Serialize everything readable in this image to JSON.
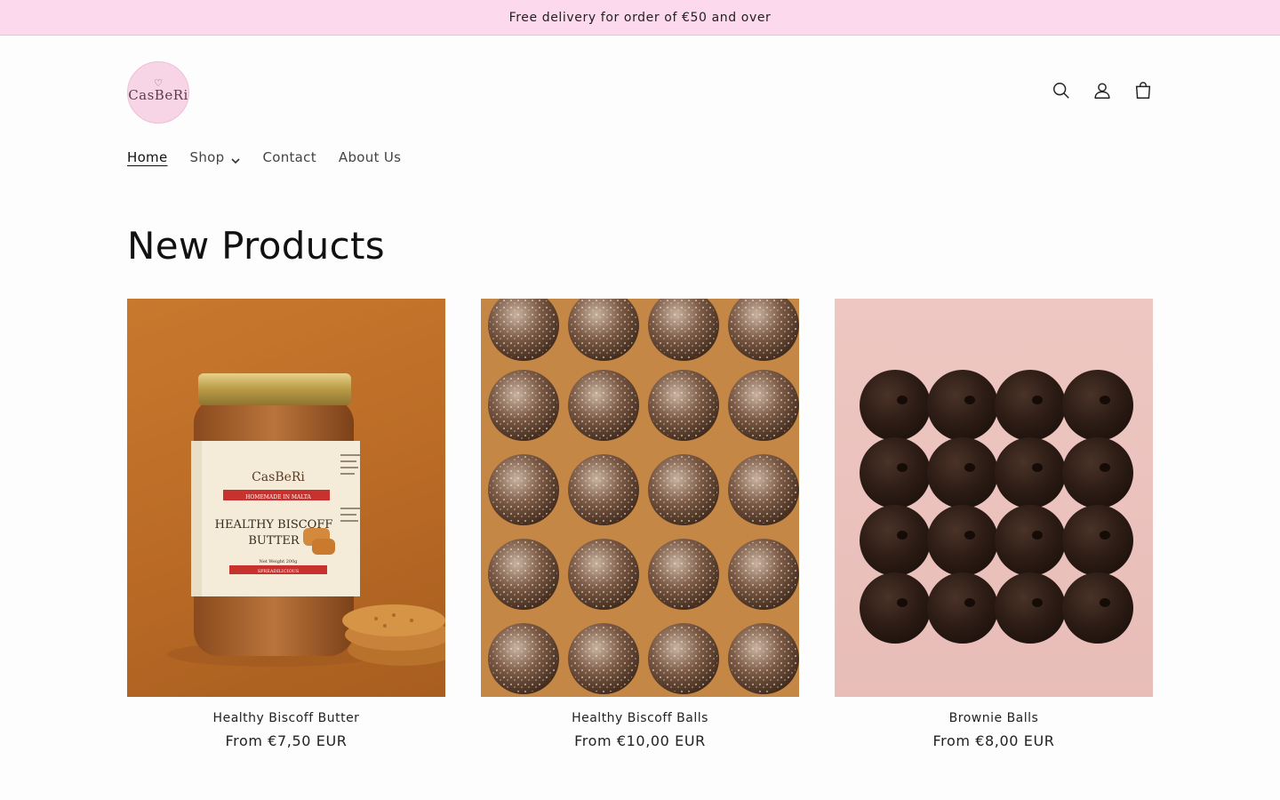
{
  "announcement": "Free delivery for order of €50 and over",
  "logo": {
    "text": "CasBeRi"
  },
  "header_icons": [
    "search-icon",
    "account-icon",
    "cart-icon"
  ],
  "nav": [
    {
      "label": "Home",
      "active": true
    },
    {
      "label": "Shop",
      "dropdown": true
    },
    {
      "label": "Contact"
    },
    {
      "label": "About Us"
    }
  ],
  "section_title": "New Products",
  "products": [
    {
      "title": "Healthy Biscoff Butter",
      "price": "From €7,50 EUR",
      "label": {
        "brand": "CasBeRi",
        "band": "HOMEMADE IN MALTA",
        "name1": "HEALTHY BISCOFF",
        "name2": "BUTTER",
        "weight": "Net Weight 200g",
        "tag": "SPREADILICIOUS"
      }
    },
    {
      "title": "Healthy Biscoff Balls",
      "price": "From €10,00 EUR"
    },
    {
      "title": "Brownie Balls",
      "price": "From €8,00 EUR"
    }
  ],
  "colors": {
    "announcement_bg": "#fcd9ec",
    "logo_bg": "#f7d4e6"
  }
}
